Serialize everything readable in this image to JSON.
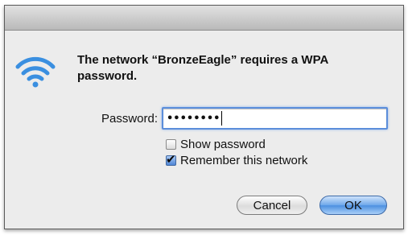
{
  "dialog": {
    "message": "The network “BronzeEagle” requires a WPA password.",
    "password_label": "Password:",
    "password_mask": "••••••••",
    "show_password": {
      "label": "Show password",
      "checked": false
    },
    "remember_network": {
      "label": "Remember this network",
      "checked": true
    },
    "cancel_label": "Cancel",
    "ok_label": "OK",
    "icon": "wifi-icon"
  },
  "colors": {
    "wifi_blue": "#3a8fe0",
    "focus_ring": "#5b8edb",
    "ok_button": "#4b8fe0"
  }
}
